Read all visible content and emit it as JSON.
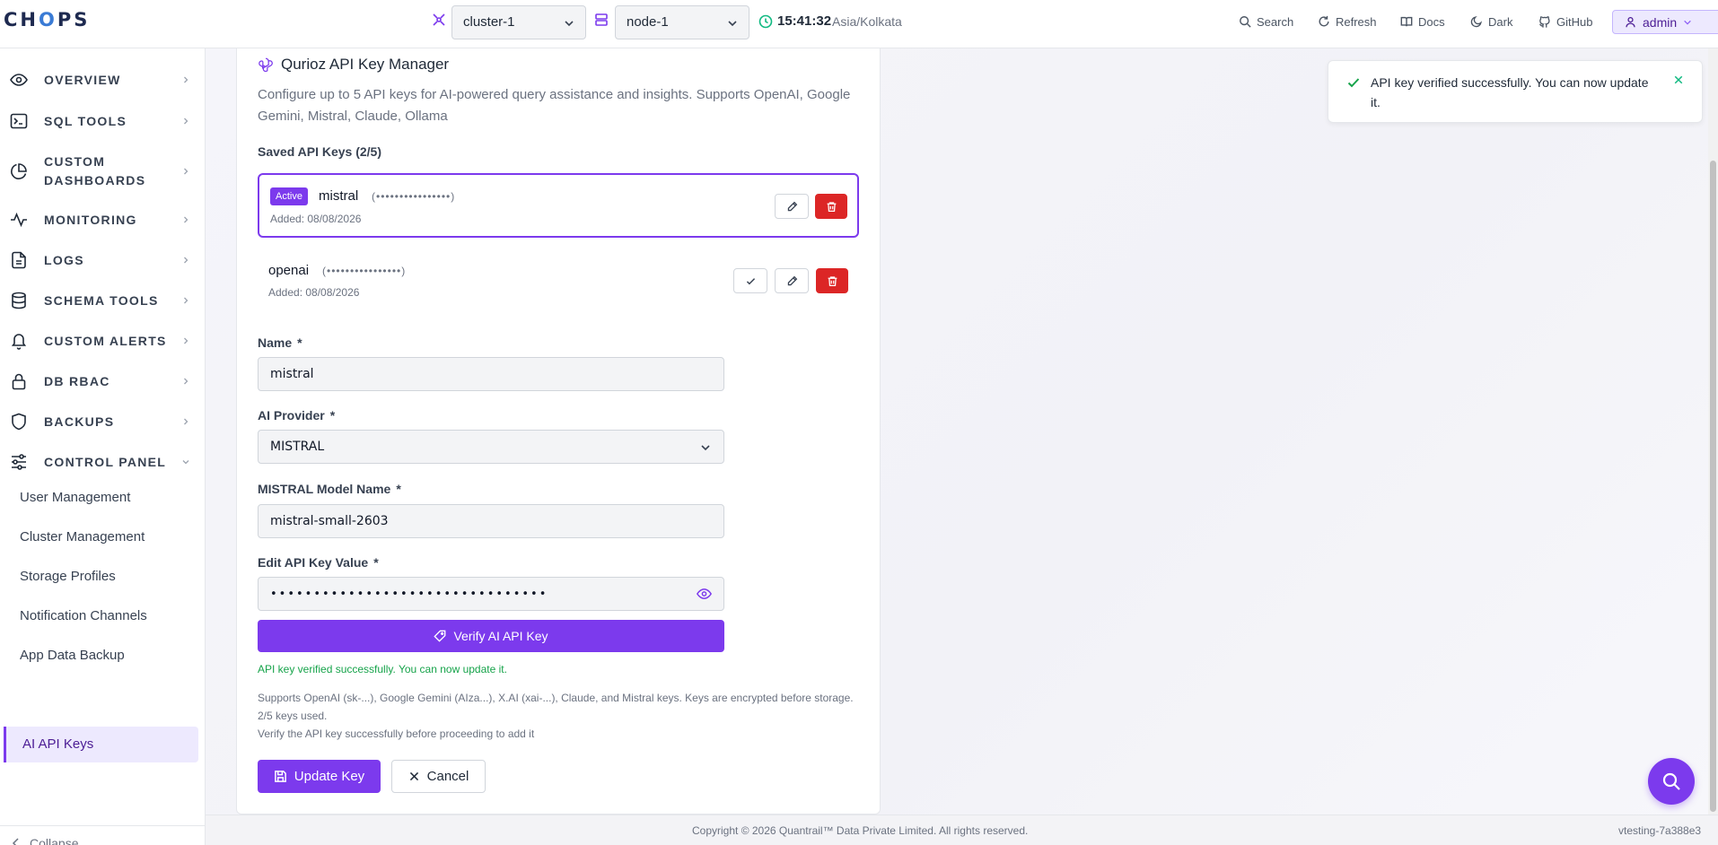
{
  "header": {
    "logo_pre": "CH",
    "logo_o": "O",
    "logo_post": "PS",
    "cluster_select": "cluster-1",
    "node_select": "node-1",
    "time": "15:41:32",
    "timezone": "Asia/Kolkata",
    "search": "Search",
    "refresh": "Refresh",
    "docs": "Docs",
    "theme": "Dark",
    "github": "GitHub",
    "user": "admin"
  },
  "sidebar": {
    "items": [
      {
        "label": "OVERVIEW",
        "icon": "eye-icon"
      },
      {
        "label": "SQL TOOLS",
        "icon": "terminal-icon"
      },
      {
        "label": "CUSTOM DASHBOARDS",
        "icon": "pie-chart-icon"
      },
      {
        "label": "MONITORING",
        "icon": "activity-icon"
      },
      {
        "label": "LOGS",
        "icon": "file-text-icon"
      },
      {
        "label": "SCHEMA TOOLS",
        "icon": "database-icon"
      },
      {
        "label": "CUSTOM ALERTS",
        "icon": "bell-icon"
      },
      {
        "label": "DB RBAC",
        "icon": "lock-icon"
      },
      {
        "label": "BACKUPS",
        "icon": "shield-icon"
      },
      {
        "label": "CONTROL PANEL",
        "icon": "sliders-icon"
      }
    ],
    "sub_items": [
      "User Management",
      "Cluster Management",
      "Storage Profiles",
      "Notification Channels",
      "App Data Backup",
      "AI API Keys"
    ],
    "collapse": "Collapse"
  },
  "card": {
    "title": "Qurioz API Key Manager",
    "description": "Configure up to 5 API keys for AI-powered query assistance and insights. Supports OpenAI, Google Gemini, Mistral, Claude, Ollama",
    "saved_heading": "Saved API Keys (2/5)",
    "keys": [
      {
        "badge": "Active",
        "name": "mistral",
        "mask": "(••••••••••••••••)",
        "added": "Added: 08/08/2026"
      },
      {
        "badge": "",
        "name": "openai",
        "mask": "(••••••••••••••••)",
        "added": "Added: 08/08/2026"
      }
    ],
    "form": {
      "name_label": "Name",
      "name_value": "mistral",
      "provider_label": "AI Provider",
      "provider_value": "MISTRAL",
      "model_label": "MISTRAL Model Name",
      "model_value": "mistral-small-2603",
      "key_label": "Edit API Key Value",
      "key_value": "••••••••••••••••••••••••••••••••",
      "required_mark": "*"
    },
    "verify_button": "Verify AI API Key",
    "verified_message": "API key verified successfully. You can now update it.",
    "help_line1": "Supports OpenAI (sk-...), Google Gemini (AIza...), X.AI (xai-...), Claude, and Mistral keys. Keys are encrypted before storage. 2/5 keys used.",
    "help_line2": "Verify the API key successfully before proceeding to add it",
    "update_button": "Update Key",
    "cancel_button": "Cancel"
  },
  "toast": {
    "message": "API key verified successfully. You can now update it."
  },
  "footer": {
    "copyright": "Copyright © 2026 Quantrail™ Data Private Limited. All rights reserved.",
    "build": "vtesting-7a388e3"
  },
  "colors": {
    "accent": "#7c3aed",
    "danger": "#dc2626",
    "success": "#16a34a"
  }
}
